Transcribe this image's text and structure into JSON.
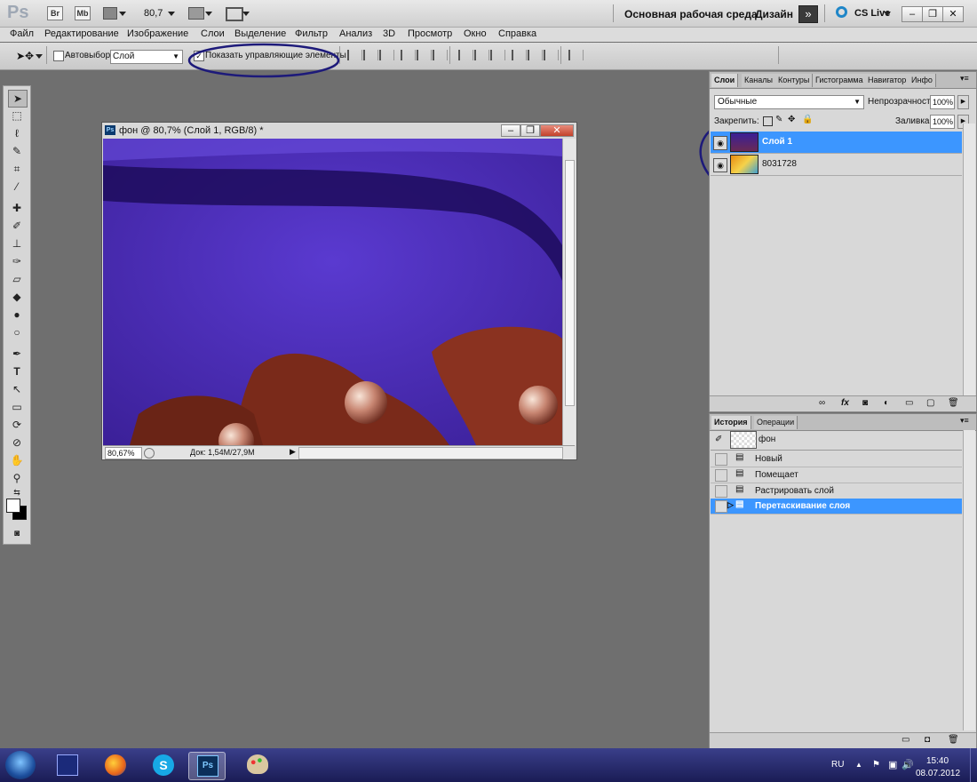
{
  "app": {
    "logo": "Ps",
    "bridge": "Br",
    "minibridge": "Mb",
    "zoom": "80,7",
    "workspace": "Основная рабочая среда",
    "design": "Дизайн",
    "cs_live": "CS Live",
    "more": "»"
  },
  "menu": [
    "Файл",
    "Редактирование",
    "Изображение",
    "Слои",
    "Выделение",
    "Фильтр",
    "Анализ",
    "3D",
    "Просмотр",
    "Окно",
    "Справка"
  ],
  "options": {
    "auto_select": "Автовыбор:",
    "auto_select_value": "Слой",
    "show_controls": "Показать управляющие элементы"
  },
  "document": {
    "title": "фон @ 80,7% (Слой 1, RGB/8) *",
    "zoom": "80,67%",
    "doc_size": "Док: 1,54М/27,9М"
  },
  "layers_panel": {
    "tabs": [
      "Слои",
      "Каналы",
      "Контуры",
      "Гистограмма",
      "Навигатор",
      "Инфо"
    ],
    "blend_mode": "Обычные",
    "opacity_label": "Непрозрачность:",
    "opacity_value": "100%",
    "lock_label": "Закрепить:",
    "fill_label": "Заливка:",
    "fill_value": "100%",
    "layers": [
      {
        "name": "Слой 1",
        "selected": true
      },
      {
        "name": "8031728",
        "selected": false
      }
    ]
  },
  "history_panel": {
    "tabs": [
      "История",
      "Операции"
    ],
    "snapshot": "фон",
    "items": [
      "Новый",
      "Помещает",
      "Растрировать слой",
      "Перетаскивание слоя"
    ],
    "active_index": 3
  },
  "taskbar": {
    "lang": "RU",
    "time": "15:40",
    "date": "08.07.2012"
  },
  "colors": {
    "selection": "#3c96ff",
    "annotation": "#1d1a7a"
  }
}
